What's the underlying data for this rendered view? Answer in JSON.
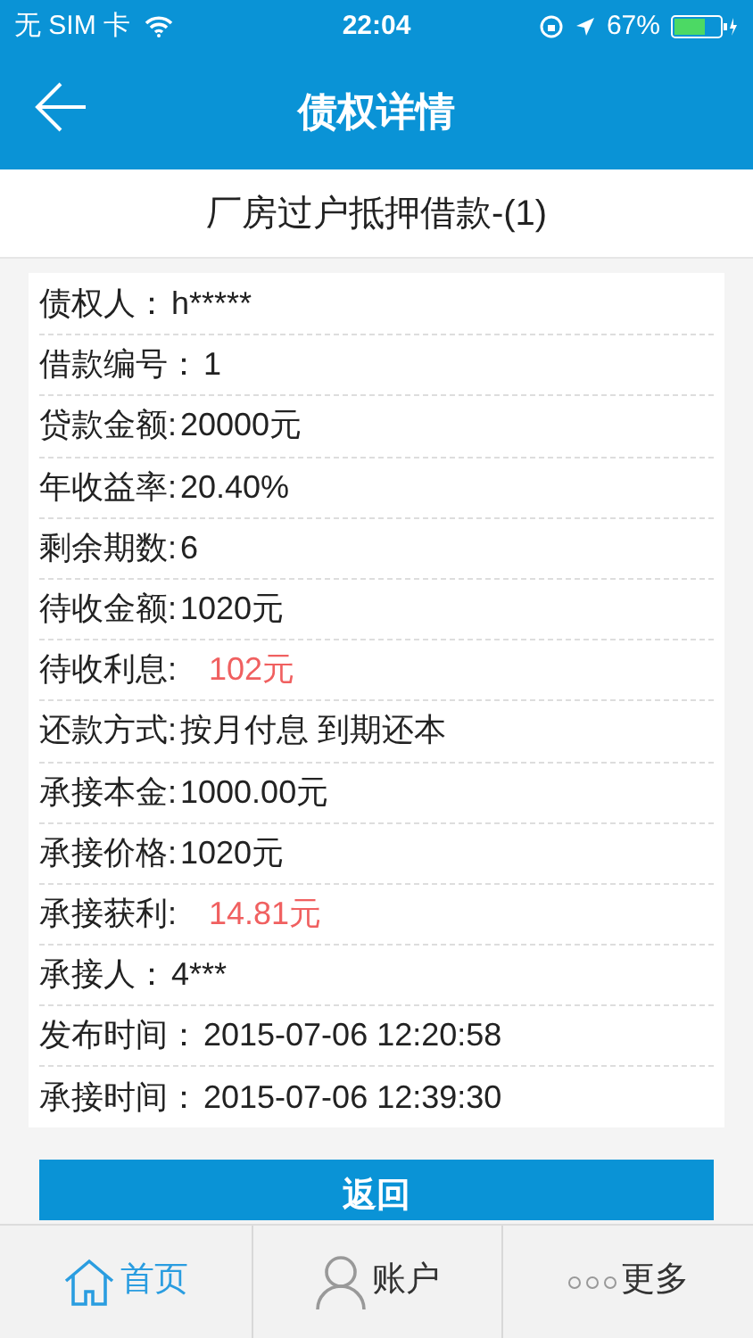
{
  "status_bar": {
    "carrier": "无 SIM 卡",
    "time": "22:04",
    "battery": "67%"
  },
  "header": {
    "title": "债权详情"
  },
  "loan_title": "厂房过户抵押借款-(1)",
  "details": [
    {
      "label": "债权人：",
      "value": "h*****",
      "kind": "plain"
    },
    {
      "label": "借款编号：",
      "value": "1",
      "kind": "plain"
    },
    {
      "label": "贷款金额:",
      "value": "20000元",
      "kind": "plain"
    },
    {
      "label": "年收益率:",
      "value": "20.40%",
      "kind": "plain"
    },
    {
      "label": "剩余期数:",
      "value": "6",
      "kind": "plain"
    },
    {
      "label": "待收金额:",
      "value": "1020元",
      "kind": "plain"
    },
    {
      "label": "待收利息:",
      "value": "102元",
      "kind": "highlight"
    },
    {
      "label": "还款方式:",
      "value": "按月付息 到期还本",
      "kind": "plain"
    },
    {
      "label": "承接本金:",
      "value": "1000.00元",
      "kind": "plain"
    },
    {
      "label": "承接价格:",
      "value": "1020元",
      "kind": "plain"
    },
    {
      "label": "承接获利:",
      "value": "14.81元",
      "kind": "highlight"
    },
    {
      "label": "承接人：",
      "value": "4***",
      "kind": "plain"
    },
    {
      "label": "发布时间：",
      "value": "2015-07-06 12:20:58",
      "kind": "plain"
    },
    {
      "label": "承接时间：",
      "value": "2015-07-06 12:39:30",
      "kind": "plain"
    }
  ],
  "back_button": "返回",
  "tabs": [
    {
      "label": "首页",
      "kind": "home",
      "selected": true
    },
    {
      "label": "账户",
      "kind": "account",
      "selected": false
    },
    {
      "label": "更多",
      "kind": "more",
      "selected": false
    }
  ]
}
